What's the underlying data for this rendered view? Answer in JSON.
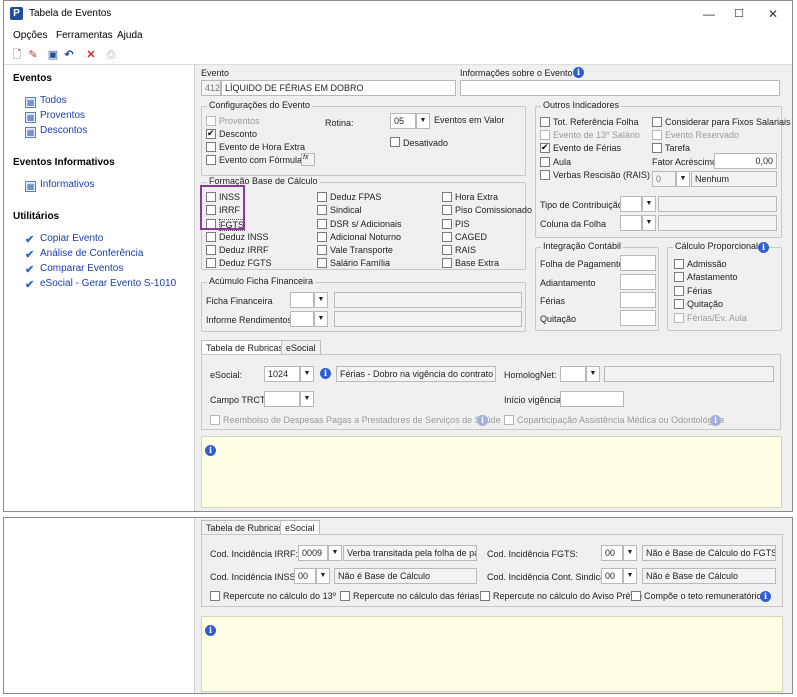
{
  "window": {
    "title": "Tabela de Eventos",
    "app_logo": "P",
    "min": "—",
    "max": "☐",
    "close": "✕"
  },
  "menu": [
    "Opções",
    "Ferramentas",
    "Ajuda"
  ],
  "toolbar_icons": [
    "new-doc-icon",
    "edit-icon",
    "save-icon",
    "undo-icon",
    "delete-icon",
    "print-icon"
  ],
  "sidebar": {
    "eventos_header": "Eventos",
    "eventos": [
      "Todos",
      "Proventos",
      "Descontos"
    ],
    "informativos_header": "Eventos Informativos",
    "informativos": [
      "Informativos"
    ],
    "utilitarios_header": "Utilitários",
    "utilitarios": [
      "Copiar Evento",
      "Análise de Conferência",
      "Comparar Eventos",
      "eSocial - Gerar Evento S-1010"
    ]
  },
  "evento": {
    "label": "Evento",
    "code": "412",
    "name": "LÍQUIDO DE FÉRIAS EM DOBRO",
    "info_label": "Informações sobre o Evento"
  },
  "config": {
    "title": "Configurações do Evento",
    "proventos": "Proventos",
    "desconto": "Desconto",
    "hora_extra": "Evento de Hora Extra",
    "formula": "Evento com Fórmula",
    "formula_icon": "fx",
    "rotina_label": "Rotina:",
    "rotina_value": "05",
    "rotina_desc": "Eventos em Valor",
    "desativado": "Desativado"
  },
  "outros": {
    "title": "Outros Indicadores",
    "tot_ref": "Tot. Referência Folha",
    "evento_13": "Evento de 13º Salário",
    "evento_ferias": "Evento de Férias",
    "aula": "Aula",
    "verbas": "Verbas Rescisão (RAIS)",
    "verbas_value": "0",
    "verbas_desc": "Nenhum",
    "fixos": "Considerar para Fixos Salariais",
    "reservado": "Evento Reservado",
    "tarefa": "Tarefa",
    "fator_label": "Fator Acréscimo",
    "fator_value": "0,00",
    "tipo_contrib": "Tipo de Contribuição",
    "coluna": "Coluna da Folha"
  },
  "formacao": {
    "title": "Formação Base de Cálculo",
    "col1": [
      "INSS",
      "IRRF",
      "FGTS",
      "Deduz INSS",
      "Deduz IRRF",
      "Deduz FGTS"
    ],
    "col2": [
      "Deduz FPAS",
      "Sindical",
      "DSR s/ Adicionais",
      "Adicional Noturno",
      "Vale Transporte",
      "Salário Família"
    ],
    "col3": [
      "Hora Extra",
      "Piso Comissionado",
      "PIS",
      "CAGED",
      "RAIS",
      "Base Extra"
    ]
  },
  "integracao": {
    "title": "Integração Contábil",
    "rows": [
      "Folha de Pagamento",
      "Adiantamento",
      "Férias",
      "Quitação"
    ]
  },
  "proporcional": {
    "title": "Cálculo Proporcional",
    "rows": [
      "Admissão",
      "Afastamento",
      "Férias",
      "Quitação",
      "Férias/Ev. Aula"
    ]
  },
  "acumulo": {
    "title": "Acúmulo Ficha Financeira",
    "ficha": "Ficha Financeira",
    "informe": "Informe Rendimentos"
  },
  "tabs": {
    "rubricas": "Tabela de Rubricas",
    "esocial": "eSocial"
  },
  "rubricas": {
    "esocial_label": "eSocial:",
    "esocial_value": "1024",
    "esocial_desc": "Férias - Dobro na vigência do contrato",
    "homolog_label": "HomologNet:",
    "trct_label": "Campo TRCT:",
    "inicio_label": "Início vigência:",
    "reembolso": "Reembolso de Despesas Pagas a Prestadores de Serviços de Saúde",
    "coparticipacao": "Coparticipação Assistência Médica ou Odontológica"
  },
  "esocial": {
    "irrf_label": "Cod. Incidência IRRF:",
    "irrf_value": "0009",
    "irrf_desc": "Verba transitada pela folha de paga",
    "fgts_label": "Cod. Incidência FGTS:",
    "fgts_value": "00",
    "fgts_desc": "Não é Base de Cálculo do FGTS",
    "inss_label": "Cod. Incidência INSS:",
    "inss_value": "00",
    "inss_desc": "Não é Base de Cálculo",
    "sind_label": "Cod. Incidência Cont. Sindical:",
    "sind_value": "00",
    "sind_desc": "Não é Base de Cálculo",
    "rep13": "Repercute no cálculo do 13º",
    "repferias": "Repercute no cálculo das férias",
    "repaviso": "Repercute no cálculo do Aviso Prévio",
    "teto": "Compõe o teto remuneratório"
  }
}
